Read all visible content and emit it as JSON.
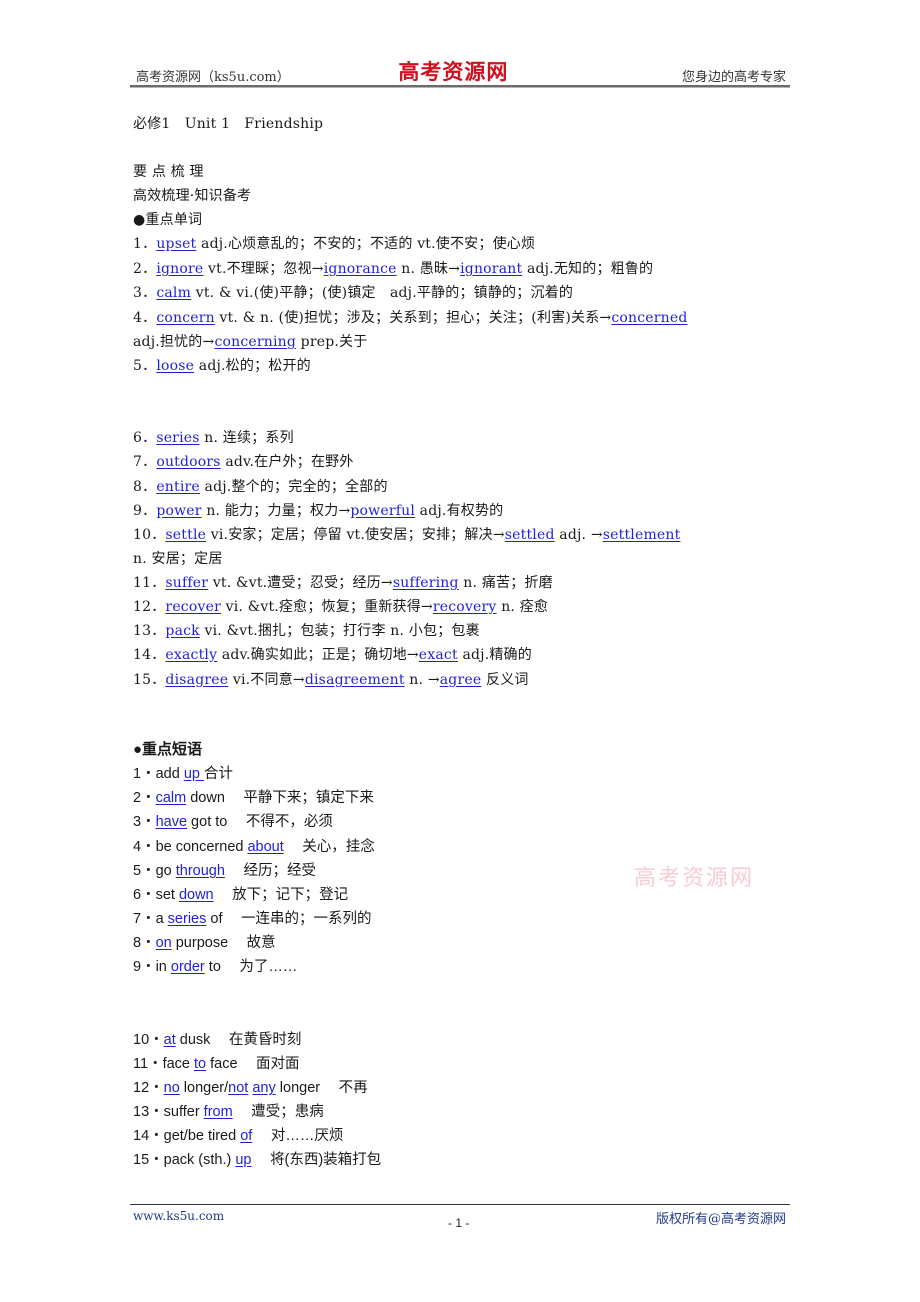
{
  "header": {
    "left": "高考资源网（ks5u.com）",
    "center_logo": "高考资源网",
    "right": "您身边的高考专家"
  },
  "title": "必修1　Unit 1　Friendship",
  "section_heading": "要 点 梳 理",
  "section_subheading": "高效梳理·知识备考",
  "vocab": {
    "heading": "●重点单词",
    "items": [
      {
        "num": "1．",
        "parts": [
          {
            "link": "upset"
          },
          {
            "text": " adj.心烦意乱的；不安的；不适的 vt.使不安；使心烦"
          }
        ]
      },
      {
        "num": "2．",
        "parts": [
          {
            "link": "ignore"
          },
          {
            "text": " vt.不理睬；忽视→"
          },
          {
            "link": "ignorance"
          },
          {
            "text": " n. 愚昧→"
          },
          {
            "link": "ignorant"
          },
          {
            "text": " adj.无知的；粗鲁的"
          }
        ]
      },
      {
        "num": "3．",
        "parts": [
          {
            "link": "calm"
          },
          {
            "text": " vt. & vi.(使)平静；(使)镇定　adj.平静的；镇静的；沉着的"
          }
        ]
      },
      {
        "num": "4．",
        "parts": [
          {
            "link": "concern"
          },
          {
            "text": " vt. & n. (使)担忧；涉及；关系到；担心；关注；(利害)关系→"
          },
          {
            "link": "concerned"
          }
        ]
      },
      {
        "num": "",
        "parts": [
          {
            "text": "adj.担忧的→"
          },
          {
            "link": "concerning"
          },
          {
            "text": " prep.关于"
          }
        ]
      },
      {
        "num": "5．",
        "parts": [
          {
            "link": "loose"
          },
          {
            "text": " adj.松的；松开的"
          }
        ]
      },
      {
        "num": "6．",
        "parts": [
          {
            "link": "series"
          },
          {
            "text": " n. 连续；系列"
          }
        ]
      },
      {
        "num": "7．",
        "parts": [
          {
            "link": "outdoors"
          },
          {
            "text": " adv.在户外；在野外"
          }
        ]
      },
      {
        "num": "8．",
        "parts": [
          {
            "link": "entire"
          },
          {
            "text": " adj.整个的；完全的；全部的"
          }
        ]
      },
      {
        "num": "9．",
        "parts": [
          {
            "link": "power"
          },
          {
            "text": " n. 能力；力量；权力→"
          },
          {
            "link": "powerful"
          },
          {
            "text": " adj.有权势的"
          }
        ]
      },
      {
        "num": "10．",
        "parts": [
          {
            "link": "settle"
          },
          {
            "text": " vi.安家；定居；停留 vt.使安居；安排；解决→"
          },
          {
            "link": "settled"
          },
          {
            "text": " adj. →"
          },
          {
            "link": "settlement"
          }
        ]
      },
      {
        "num": "",
        "parts": [
          {
            "text": "n. 安居；定居"
          }
        ]
      },
      {
        "num": "11．",
        "parts": [
          {
            "link": "suffer"
          },
          {
            "text": " vt. &vt.遭受；忍受；经历→"
          },
          {
            "link": "suffering"
          },
          {
            "text": " n. 痛苦；折磨"
          }
        ]
      },
      {
        "num": "12．",
        "parts": [
          {
            "link": "recover"
          },
          {
            "text": " vi. &vt.痊愈；恢复；重新获得→"
          },
          {
            "link": "recovery"
          },
          {
            "text": " n. 痊愈"
          }
        ]
      },
      {
        "num": "13．",
        "parts": [
          {
            "link": "pack"
          },
          {
            "text": " vi. &vt.捆扎；包装；打行李 n. 小包；包裹"
          }
        ]
      },
      {
        "num": "14．",
        "parts": [
          {
            "link": "exactly"
          },
          {
            "text": " adv.确实如此；正是；确切地→"
          },
          {
            "link": "exact"
          },
          {
            "text": " adj.精确的"
          }
        ]
      },
      {
        "num": "15．",
        "parts": [
          {
            "link": "disagree"
          },
          {
            "text": " vi.不同意→"
          },
          {
            "link": "disagreement"
          },
          {
            "text": " n. →"
          },
          {
            "link": "agree"
          },
          {
            "text": " 反义词"
          }
        ]
      }
    ]
  },
  "phrases": {
    "heading": "●重点短语",
    "items": [
      {
        "num": "1・",
        "parts": [
          {
            "text": "add "
          },
          {
            "link": "up "
          },
          {
            "text": "合计"
          }
        ]
      },
      {
        "num": "2・",
        "parts": [
          {
            "link": "calm"
          },
          {
            "text": " down　 平静下来；镇定下来"
          }
        ]
      },
      {
        "num": "3・",
        "parts": [
          {
            "link": "have"
          },
          {
            "text": " got to　 不得不，必须"
          }
        ]
      },
      {
        "num": "4・",
        "parts": [
          {
            "text": "be concerned "
          },
          {
            "link": "about"
          },
          {
            "text": "　 关心，挂念"
          }
        ]
      },
      {
        "num": "5・",
        "parts": [
          {
            "text": "go "
          },
          {
            "link": "through"
          },
          {
            "text": "　 经历；经受"
          }
        ]
      },
      {
        "num": "6・",
        "parts": [
          {
            "text": "set "
          },
          {
            "link": "down"
          },
          {
            "text": "　 放下；记下；登记"
          }
        ]
      },
      {
        "num": "7・",
        "parts": [
          {
            "text": "a "
          },
          {
            "link": "series"
          },
          {
            "text": " of　 一连串的；一系列的"
          }
        ]
      },
      {
        "num": "8・",
        "parts": [
          {
            "link": "on"
          },
          {
            "text": " purpose　 故意"
          }
        ]
      },
      {
        "num": "9・",
        "parts": [
          {
            "text": "in "
          },
          {
            "link": "order"
          },
          {
            "text": " to　 为了……"
          }
        ]
      },
      {
        "num": "10・",
        "parts": [
          {
            "link": "at"
          },
          {
            "text": " dusk　 在黄昏时刻"
          }
        ]
      },
      {
        "num": "11・",
        "parts": [
          {
            "text": "face "
          },
          {
            "link": "to"
          },
          {
            "text": " face　 面对面"
          }
        ]
      },
      {
        "num": "12・",
        "parts": [
          {
            "link": "no"
          },
          {
            "text": " longer/"
          },
          {
            "link": "not"
          },
          {
            "text": " "
          },
          {
            "link": "any"
          },
          {
            "text": " longer　 不再"
          }
        ]
      },
      {
        "num": "13・",
        "parts": [
          {
            "text": "suffer "
          },
          {
            "link": "from"
          },
          {
            "text": "　 遭受；患病"
          }
        ]
      },
      {
        "num": "14・",
        "parts": [
          {
            "text": "get/be tired "
          },
          {
            "link": "of"
          },
          {
            "text": "　 对……厌烦"
          }
        ]
      },
      {
        "num": "15・",
        "parts": [
          {
            "text": "pack (sth.) "
          },
          {
            "link": "up"
          },
          {
            "text": "　 将(东西)装箱打包"
          }
        ]
      }
    ]
  },
  "watermark": "高考资源网",
  "footer": {
    "left": "www.ks5u.com",
    "page": "- 1 -",
    "right": "版权所有@高考资源网"
  },
  "colors": {
    "link": "#1f1fd6",
    "logo": "#d0101e",
    "watermark": "#f5c4cd"
  }
}
